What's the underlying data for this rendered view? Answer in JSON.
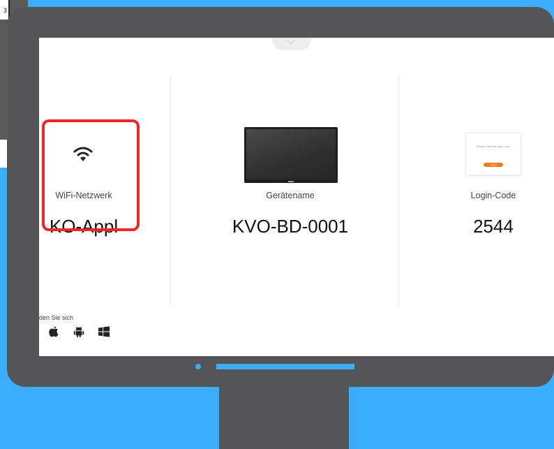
{
  "background": {
    "corner_text": "3"
  },
  "screen": {
    "wifi": {
      "label": "WiFi-Netzwerk",
      "value": "KO-Appl"
    },
    "device": {
      "label": "Gerätename",
      "value": "KVO-BD-0001"
    },
    "login": {
      "label": "Login-Code",
      "value": "2544",
      "card_prompt": "Please enter the login code",
      "card_button": "Submit"
    },
    "connect": {
      "text": "den Sie sich",
      "platforms": [
        "apple-icon",
        "android-icon",
        "windows-icon"
      ]
    }
  },
  "colors": {
    "background": "#3aaefa",
    "monitor": "#555557",
    "highlight": "#f0262b",
    "accent": "#ec7c1a"
  }
}
